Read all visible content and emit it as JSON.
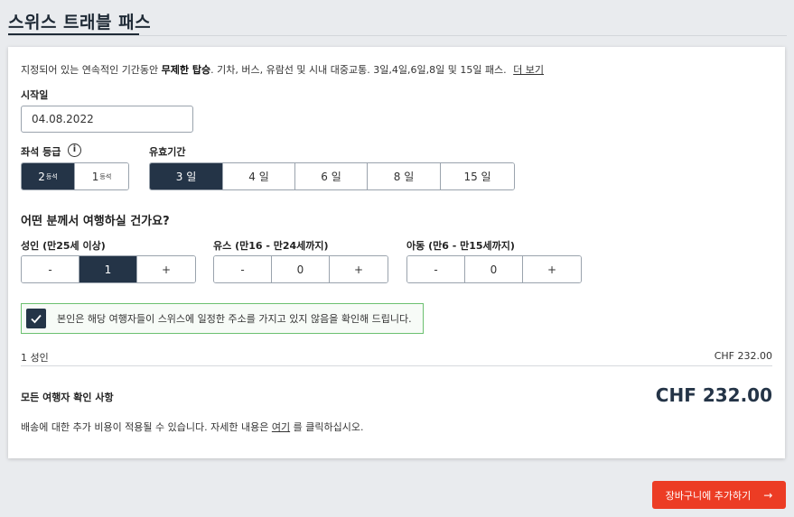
{
  "page": {
    "title": "스위스 트래블 패스"
  },
  "intro": {
    "text_before": "지정되어 있는 연속적인 기간동안 ",
    "text_bold": "무제한 탑승",
    "text_after": ". 기차, 버스, 유람선 및 시내 대중교통. 3일,4일,6일,8일 및 15일 패스.",
    "more_link": "더 보기"
  },
  "start_date": {
    "label": "시작일",
    "value": "04.08.2022"
  },
  "seat_class": {
    "label": "좌석 등급",
    "info_icon": "i",
    "options": [
      {
        "number": "2",
        "suffix": "등석",
        "selected": true
      },
      {
        "number": "1",
        "suffix": "등석",
        "selected": false
      }
    ]
  },
  "validity": {
    "label": "유효기간",
    "options": [
      {
        "label": "3 일",
        "selected": true
      },
      {
        "label": "4 일",
        "selected": false
      },
      {
        "label": "6 일",
        "selected": false
      },
      {
        "label": "8 일",
        "selected": false
      },
      {
        "label": "15 일",
        "selected": false
      }
    ]
  },
  "travellers": {
    "question": "어떤 분께서 여행하실 건가요?",
    "adult": {
      "label": "성인 (만25세 이상)",
      "minus": "-",
      "value": "1",
      "plus": "+"
    },
    "youth": {
      "label": "유스 (만16 - 만24세까지)",
      "minus": "-",
      "value": "0",
      "plus": "+"
    },
    "child": {
      "label": "아동 (만6 - 만15세까지)",
      "minus": "-",
      "value": "0",
      "plus": "+"
    }
  },
  "confirmation": {
    "checked": true,
    "text": "본인은 해당 여행자들이 스위스에 일정한 주소를 가지고 있지 않음을 확인해 드립니다."
  },
  "summary": {
    "line_label": "1 성인",
    "line_price": "CHF 232.00"
  },
  "total": {
    "label": "모든 여행자 확인 사항",
    "price": "CHF 232.00"
  },
  "shipping": {
    "text_before": "배송에 대한 추가 비용이 적용될 수 있습니다. 자세한 내용은 ",
    "link": "여기",
    "text_after": " 를 클릭하십시오."
  },
  "cart_button": {
    "label": "장바구니에 추가하기",
    "arrow": "→"
  },
  "colors": {
    "primary_dark": "#243447",
    "accent_red": "#ec3c24",
    "confirm_green": "#6cc070"
  }
}
